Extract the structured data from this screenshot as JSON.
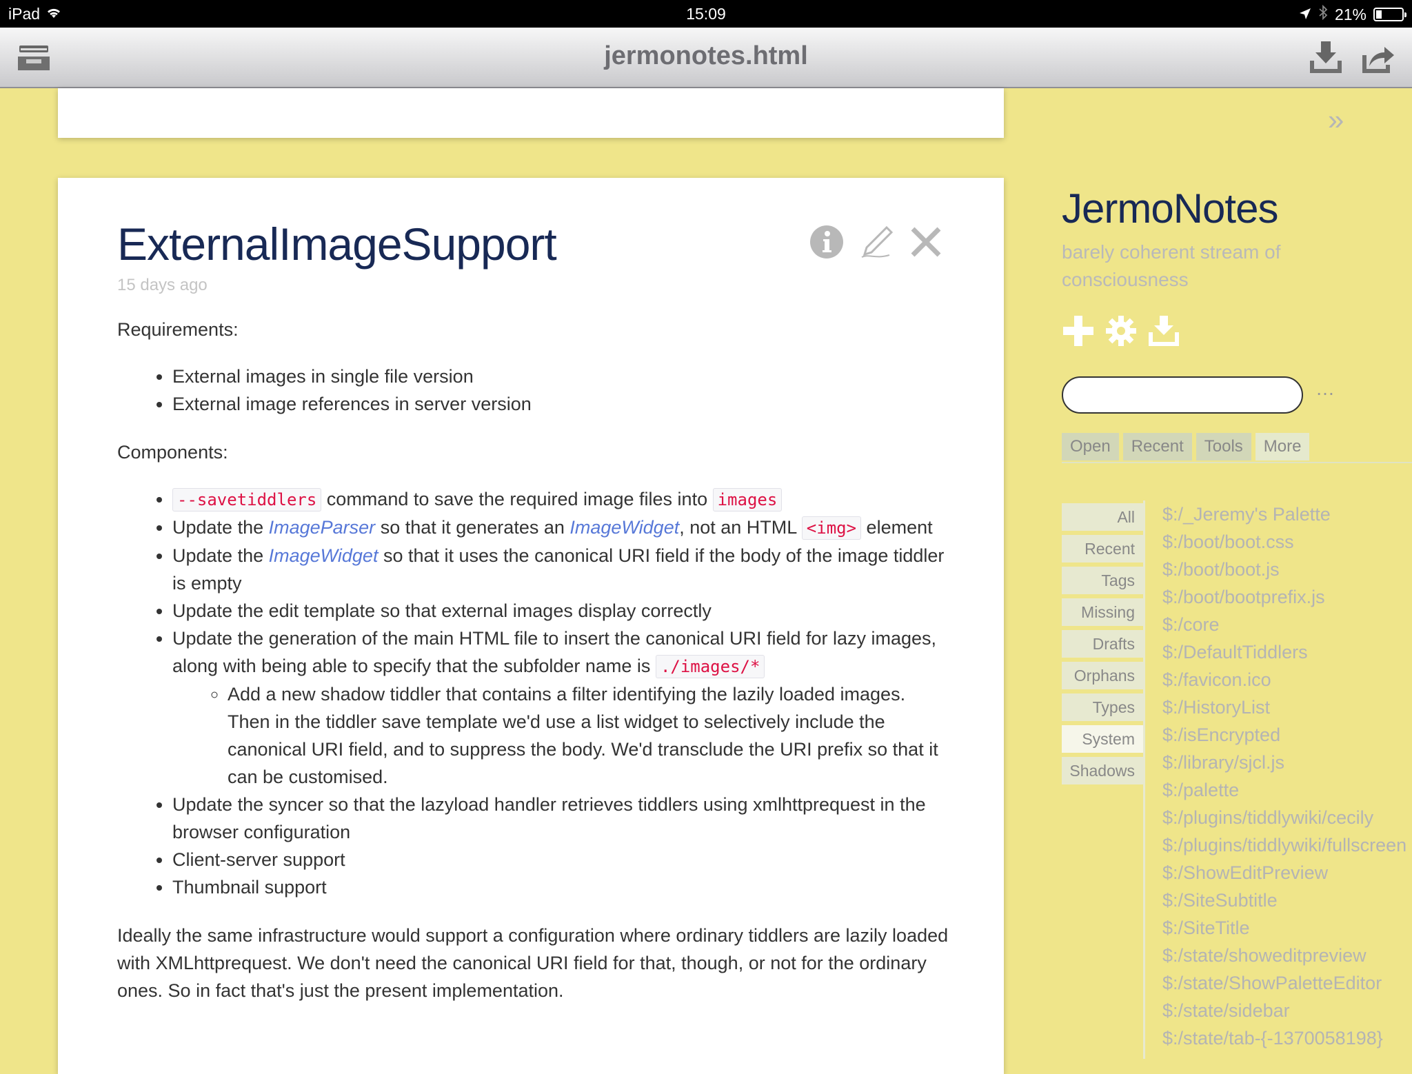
{
  "status_bar": {
    "device": "iPad",
    "time": "15:09",
    "battery": "21%",
    "battery_level": 0.21
  },
  "nav_bar": {
    "title": "jermonotes.html",
    "icons": [
      "inbox-icon",
      "download-icon",
      "share-icon"
    ]
  },
  "tiddler": {
    "title": "ExternalImageSupport",
    "date": "15 days ago",
    "controls": [
      "info-icon",
      "edit-icon",
      "close-icon"
    ],
    "requirements_heading": "Requirements:",
    "requirements": [
      "External images in single file version",
      "External image references in server version"
    ],
    "components_heading": "Components:",
    "c1": {
      "code1": "--savetiddlers",
      "text": " command to save the required image files into ",
      "code2": "images"
    },
    "c2": {
      "a": "Update the ",
      "link1": "ImageParser",
      "b": " so that it generates an ",
      "link2": "ImageWidget",
      "c": ", not an HTML ",
      "code": "<img>",
      "d": " element"
    },
    "c3": {
      "a": "Update the ",
      "link": "ImageWidget",
      "b": " so that it uses the canonical URI field if the body of the image tiddler is empty"
    },
    "c4": "Update the edit template so that external images display correctly",
    "c5": {
      "a": "Update the generation of the main HTML file to insert the canonical URI field for lazy images, along with being able to specify that the subfolder name is ",
      "code": "./images/*"
    },
    "c5_sub": "Add a new shadow tiddler that contains a filter identifying the lazily loaded images. Then in the tiddler save template we'd use a list widget to selectively include the canonical URI field, and to suppress the body. We'd transclude the URI prefix so that it can be customised.",
    "c6": "Update the syncer so that the lazyload handler retrieves tiddlers using xmlhttprequest in the browser configuration",
    "c7": "Client-server support",
    "c8": "Thumbnail support",
    "closing": "Ideally the same infrastructure would support a configuration where ordinary tiddlers are lazily loaded with XMLhttprequest. We don't need the canonical URI field for that, though, or not for the ordinary ones. So in fact that's just the present implementation."
  },
  "sidebar": {
    "chevron": "»",
    "site_title": "JermoNotes",
    "site_subtitle": "barely coherent stream of consciousness",
    "buttons": [
      "plus-icon",
      "gear-icon",
      "save-icon"
    ],
    "search_value": "",
    "search_more": "…",
    "tabs": [
      "Open",
      "Recent",
      "Tools",
      "More"
    ],
    "active_tab": "More",
    "list_tabs": [
      "All",
      "Recent",
      "Tags",
      "Missing",
      "Drafts",
      "Orphans",
      "Types",
      "System",
      "Shadows"
    ],
    "active_list_tab": "System",
    "items": [
      "$:/_Jeremy's Palette",
      "$:/boot/boot.css",
      "$:/boot/boot.js",
      "$:/boot/bootprefix.js",
      "$:/core",
      "$:/DefaultTiddlers",
      "$:/favicon.ico",
      "$:/HistoryList",
      "$:/isEncrypted",
      "$:/library/sjcl.js",
      "$:/palette",
      "$:/plugins/tiddlywiki/cecily",
      "$:/plugins/tiddlywiki/fullscreen",
      "$:/ShowEditPreview",
      "$:/SiteSubtitle",
      "$:/SiteTitle",
      "$:/state/showeditpreview",
      "$:/state/ShowPaletteEditor",
      "$:/state/sidebar",
      "$:/state/tab-{-1370058198}"
    ]
  }
}
